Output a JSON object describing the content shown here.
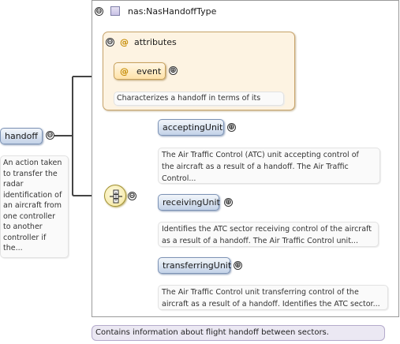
{
  "root_element": {
    "name": "handoff",
    "doc": [
      "An action taken",
      "to transfer the",
      "radar",
      "identification of",
      "an aircraft from",
      "one controller",
      "to another",
      "controller if",
      "the..."
    ]
  },
  "type": {
    "label": "nas:NasHandoffType",
    "doc": "Contains information about flight handoff between sectors."
  },
  "attributes": {
    "label": "attributes",
    "items": [
      {
        "name": "event",
        "doc": "Characterizes a handoff in terms of its status."
      }
    ]
  },
  "sequence": {
    "children": [
      {
        "name": "acceptingUnit",
        "doc": [
          "The Air Traffic Control (ATC) unit accepting control of",
          "the aircraft as a result of a handoff. The Air Traffic",
          "Control..."
        ]
      },
      {
        "name": "receivingUnit",
        "doc": [
          "Identifies the ATC sector receiving control of the aircraft",
          "as a result of a handoff. The Air Traffic Control unit..."
        ]
      },
      {
        "name": "transferringUnit",
        "doc": [
          "The Air Traffic Control unit transferring control of the",
          "aircraft as a result of a handoff. Identifies the ATC sector..."
        ]
      }
    ]
  },
  "symbols": {
    "collapse": "⊖",
    "expand": "⊕",
    "attribute_marker": "@"
  }
}
